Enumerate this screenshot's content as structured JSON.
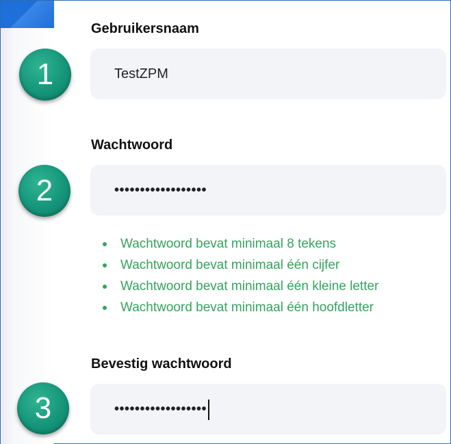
{
  "form": {
    "username": {
      "label": "Gebruikersnaam",
      "value": "TestZPM"
    },
    "password": {
      "label": "Wachtwoord",
      "masked_value": "••••••••••••••••••"
    },
    "password_rules": [
      "Wachtwoord bevat minimaal 8 tekens",
      "Wachtwoord bevat minimaal één cijfer",
      "Wachtwoord bevat minimaal één kleine letter",
      "Wachtwoord bevat minimaal één hoofdletter"
    ],
    "confirm_password": {
      "label": "Bevestig wachtwoord",
      "masked_value": "••••••••••••••••••"
    }
  },
  "steps": [
    "1",
    "2",
    "3"
  ],
  "colors": {
    "step_badge": "#15957a",
    "rule_text": "#34a35e",
    "field_bg": "#f2f4f7",
    "frame_border": "#2b6cb0"
  }
}
